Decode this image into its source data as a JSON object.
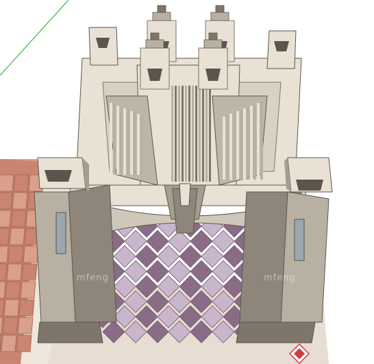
{
  "viewport": {
    "title": "",
    "background": "#ffffff"
  },
  "palette": {
    "ground_light": "#efe6dc",
    "tile_terracotta": "#c98572",
    "tile_terracotta_light": "#d9a08c",
    "tile_purple": "#8a6c88",
    "tile_lavender": "#c9b6cc",
    "mosaic_border": "#e7ddd3",
    "stone_light": "#e8e1d4",
    "stone_mid": "#b8b0a2",
    "stone_dark": "#7e766b",
    "stone_shadow": "#5b554d",
    "glass": "#9aa6b0",
    "axis_green": "#3cb043"
  },
  "watermarks": [
    {
      "text": "mfeng"
    },
    {
      "text": "mfeng"
    }
  ],
  "logo": {
    "icon": "site-logo-icon",
    "color": "#d43a3a"
  }
}
